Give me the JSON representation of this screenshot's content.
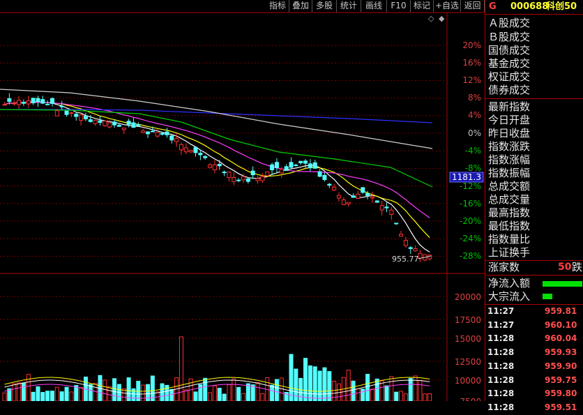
{
  "toolbar": {
    "buttons": [
      "指标",
      "叠加",
      "多股",
      "统计",
      "画线",
      "F10",
      "标记",
      "+自选",
      "返回"
    ]
  },
  "header": {
    "flag": "G",
    "code": "000688",
    "name": "科创50"
  },
  "chart": {
    "pct_labels": [
      "20%",
      "16%",
      "12%",
      "8%",
      "4%",
      "0%",
      "-4%",
      "-8%",
      "-12%",
      "-16%",
      "-20%",
      "-24%",
      "-28%"
    ],
    "current_price_label": "1181.3",
    "low_price_label": "955.77",
    "volume_labels": [
      "20000",
      "17500",
      "15000",
      "12500",
      "10000",
      "7500"
    ]
  },
  "sidebar": {
    "items": [
      "Ａ股成交",
      "Ｂ股成交",
      "国债成交",
      "基金成交",
      "权证成交",
      "债券成交",
      "最新指数",
      "今日开盘",
      "昨日收盘",
      "指数涨跌",
      "指数涨幅",
      "指数振幅",
      "总成交额",
      "总成交量",
      "最高指数",
      "最低指数",
      "指数量比",
      "上证换手"
    ],
    "rise_label": "涨家数",
    "rise_value": "50",
    "fall_label": "跌",
    "net_inflow_label": "净流入额",
    "block_inflow_label": "大宗流入"
  },
  "ticks": [
    {
      "time": "11:27",
      "price": "959.81"
    },
    {
      "time": "11:27",
      "price": "960.10"
    },
    {
      "time": "11:28",
      "price": "960.04"
    },
    {
      "time": "11:28",
      "price": "959.93"
    },
    {
      "time": "11:28",
      "price": "959.90"
    },
    {
      "time": "11:28",
      "price": "959.75"
    },
    {
      "time": "11:28",
      "price": "959.80"
    },
    {
      "time": "11:28",
      "price": "959.51"
    }
  ],
  "colors": {
    "up": "#ff3030",
    "down": "#54ffff",
    "ma5": "#ffffff",
    "ma10": "#ffff00",
    "ma20": "#ff40ff",
    "ma60": "#00d000",
    "ma120": "#d0d0d0",
    "ma250": "#3030ff"
  }
}
